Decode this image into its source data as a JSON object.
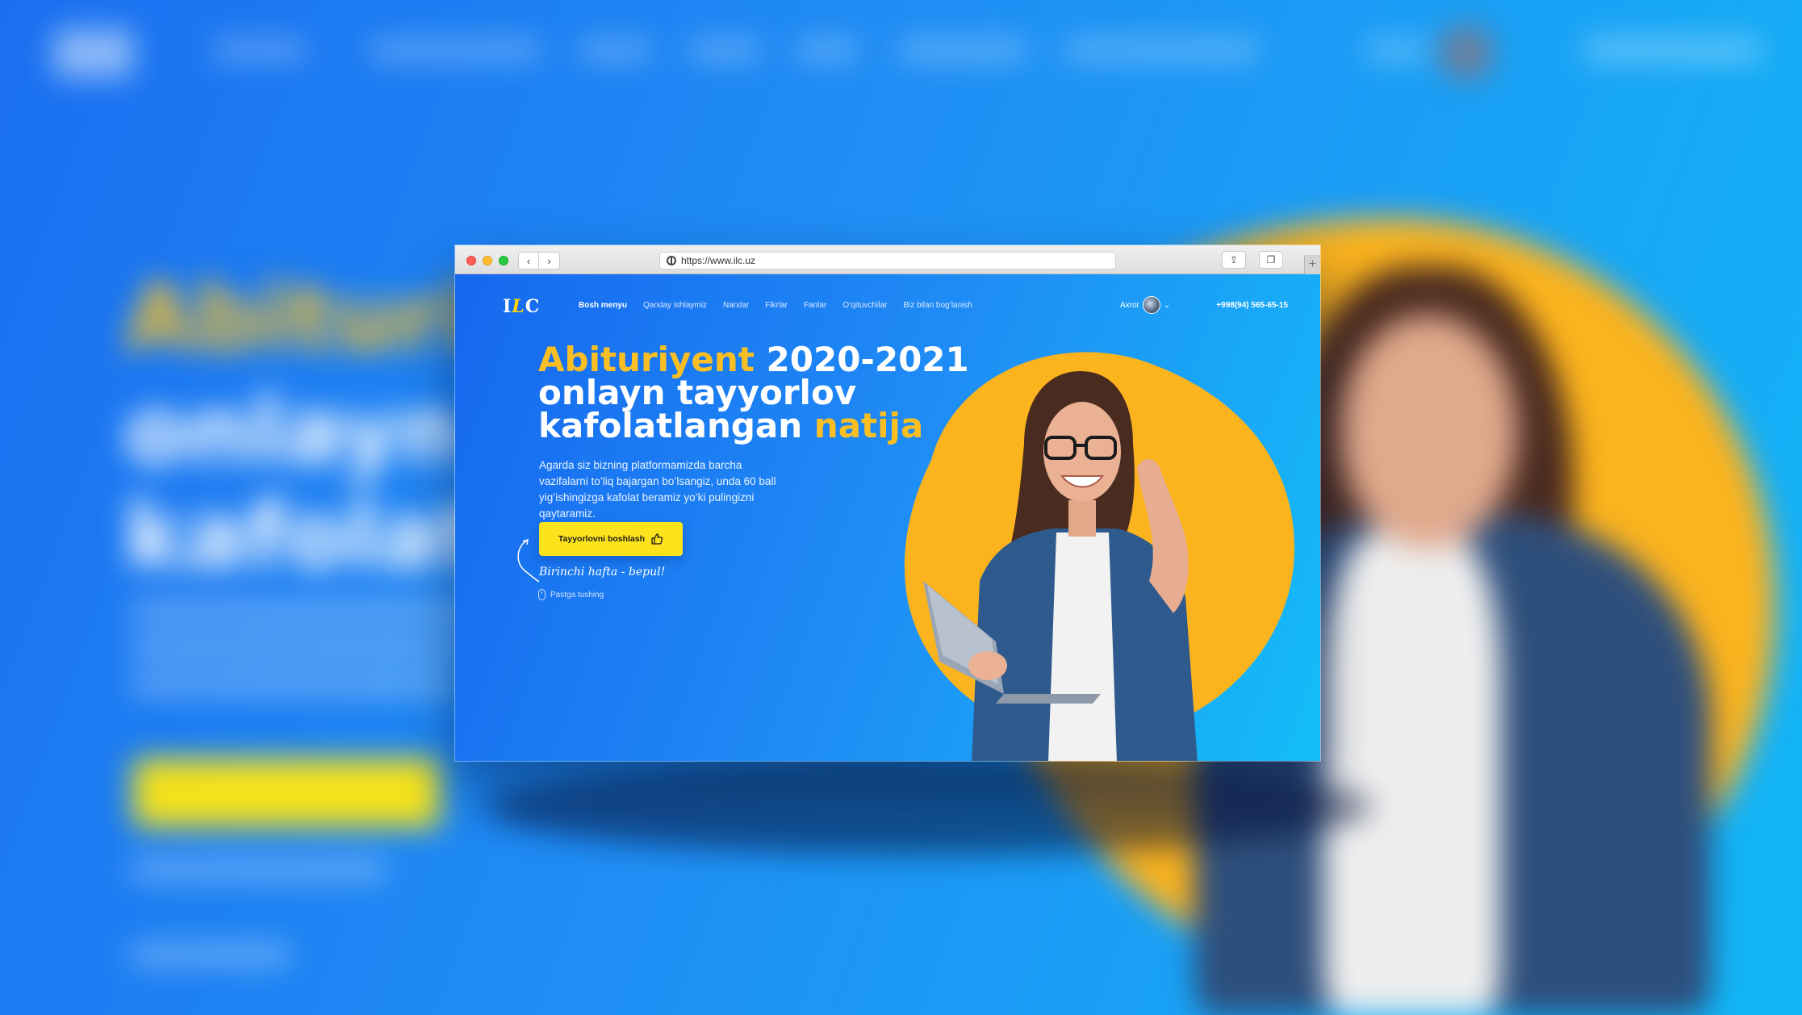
{
  "browser": {
    "url": "https://www.ilc.uz",
    "back_glyph": "‹",
    "forward_glyph": "›",
    "share_glyph": "⇪",
    "tabs_glyph": "❐",
    "new_tab_glyph": "+"
  },
  "site": {
    "logo": {
      "first": "I",
      "middle": "L",
      "last": "C"
    },
    "menu": [
      {
        "label": "Bosh menyu",
        "active": true
      },
      {
        "label": "Qanday ishlaymiz"
      },
      {
        "label": "Narxlar"
      },
      {
        "label": "Fikrlar"
      },
      {
        "label": "Fanlar"
      },
      {
        "label": "O’qituvchilar"
      },
      {
        "label": "Biz bilan bog’lanish"
      }
    ],
    "user_name": "Axror",
    "user_chevron": "⌄",
    "phone": "+998(94) 565-65-15"
  },
  "hero": {
    "line1_yellow": "Abituriyent",
    "line1_white": "2020-2021",
    "line2": "onlayn tayyorlov",
    "line3_white": "kafolatlangan",
    "line3_yellow": "natija",
    "description": "Agarda siz bizning platformamizda barcha vazifalarni to’liq bajargan bo’lsangiz, unda  60 ball yig’ishingizga kafolat beramiz yo’ki pulingizni qaytaramiz.",
    "cta_label": "Tayyorlovni boshlash",
    "free_note": "Birinchi hafta - bepul!",
    "scroll_hint": "Pastga tushing"
  },
  "colors": {
    "accent_yellow": "#fbbf24",
    "cta_yellow": "#fde31c",
    "blob_orange": "#fbb31e",
    "bg_blue_start": "#1668ef",
    "bg_blue_end": "#14bdf8"
  }
}
